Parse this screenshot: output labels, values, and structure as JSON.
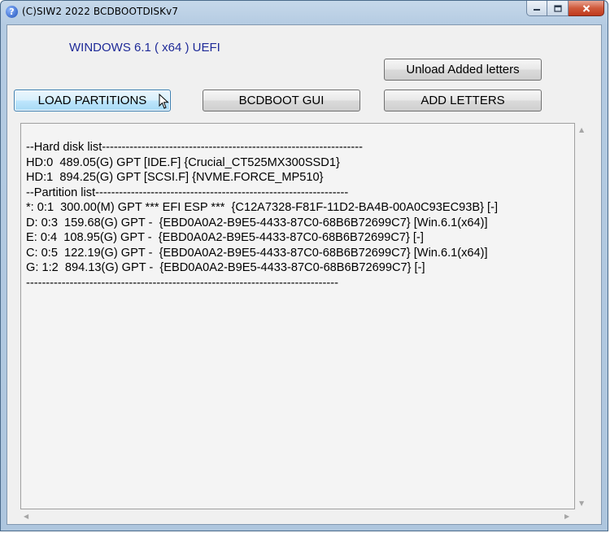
{
  "window": {
    "title": "(C)SIW2 2022 BCDBOOTDISKv7",
    "icon": "question-icon"
  },
  "controls": {
    "minimize_icon": "minimize-icon",
    "maximize_icon": "maximize-icon",
    "close_icon": "close-icon"
  },
  "heading": "WINDOWS 6.1 ( x64 ) UEFI",
  "buttons": {
    "unload": "Unload Added letters",
    "load_partitions": "LOAD PARTITIONS",
    "bcdboot_gui": "BCDBOOT GUI",
    "add_letters": "ADD LETTERS"
  },
  "output": {
    "lines": [
      "--Hard disk list------------------------------------------------------------------",
      "HD:0  489.05(G) GPT [IDE.F] {Crucial_CT525MX300SSD1}",
      "HD:1  894.25(G) GPT [SCSI.F] {NVME.FORCE_MP510}",
      "--Partition list----------------------------------------------------------------",
      "*: 0:1  300.00(M) GPT *** EFI ESP ***  {C12A7328-F81F-11D2-BA4B-00A0C93EC93B} [-]",
      "D: 0:3  159.68(G) GPT -  {EBD0A0A2-B9E5-4433-87C0-68B6B72699C7} [Win.6.1(x64)]",
      "E: 0:4  108.95(G) GPT -  {EBD0A0A2-B9E5-4433-87C0-68B6B72699C7} [-]",
      "C: 0:5  122.19(G) GPT -  {EBD0A0A2-B9E5-4433-87C0-68B6B72699C7} [Win.6.1(x64)]",
      "G: 1:2  894.13(G) GPT -  {EBD0A0A2-B9E5-4433-87C0-68B6B72699C7} [-]",
      "-------------------------------------------------------------------------------"
    ]
  }
}
